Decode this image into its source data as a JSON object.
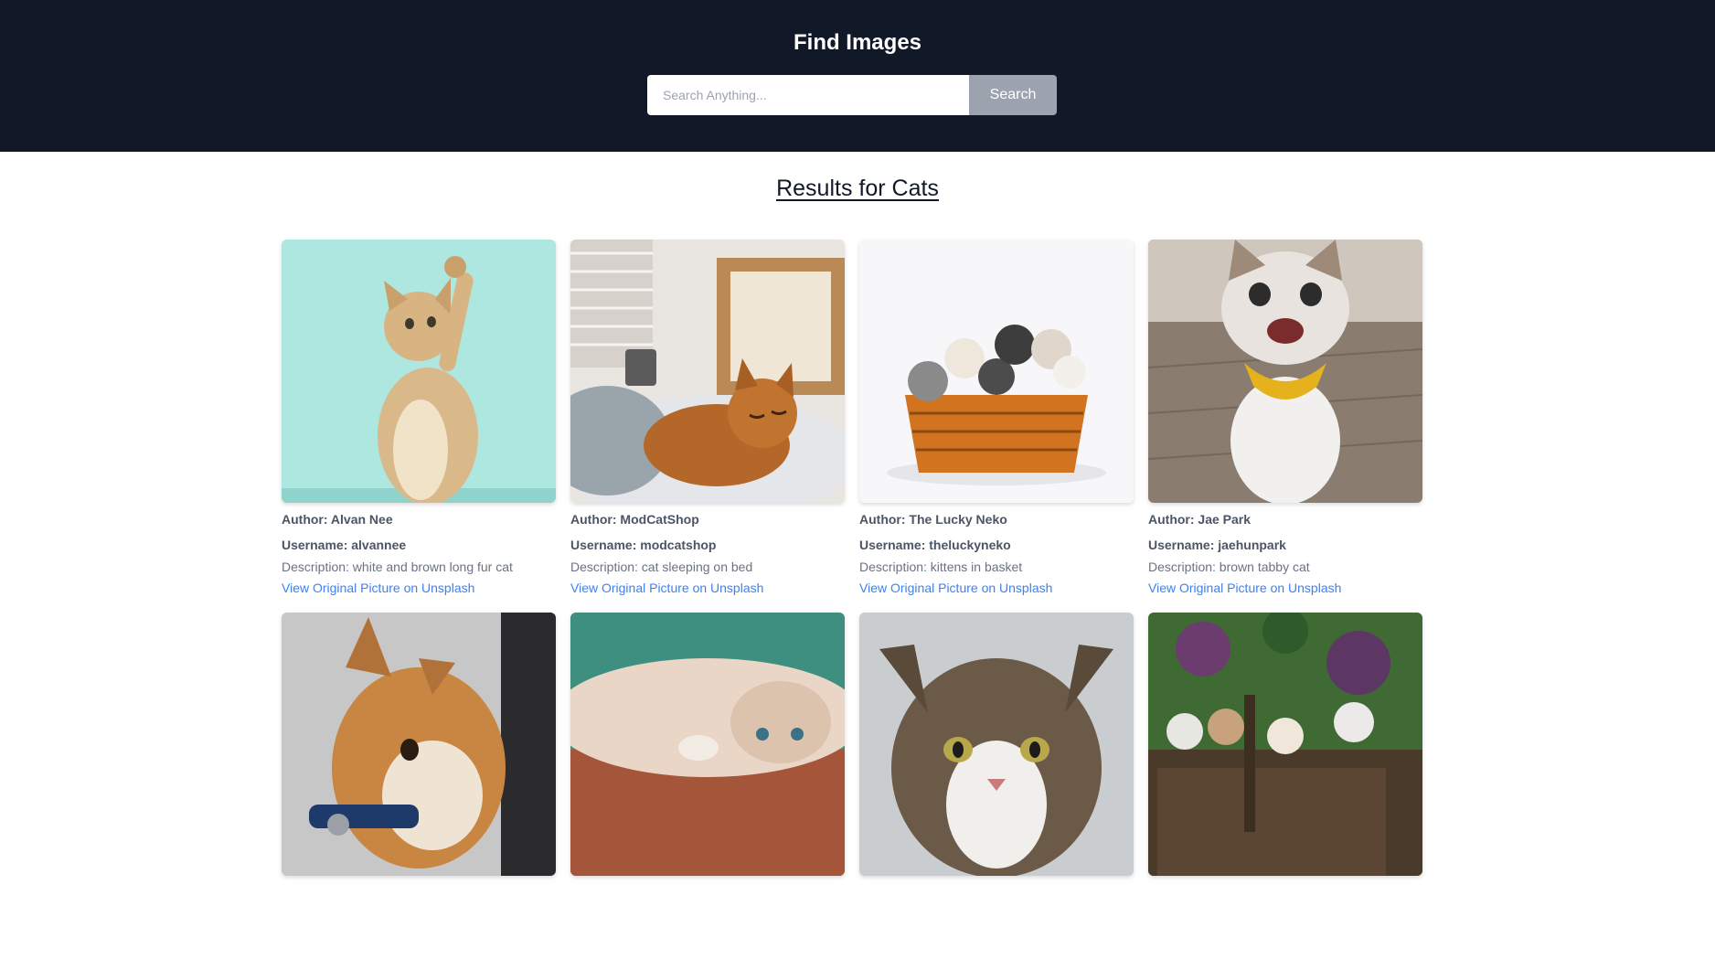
{
  "header": {
    "title": "Find Images",
    "search_placeholder": "Search Anything...",
    "search_button": "Search",
    "background": "#111827"
  },
  "results": {
    "prefix": "Results for ",
    "query": "Cats"
  },
  "cards": [
    {
      "author": "Author: Alvan Nee",
      "username": "Username: alvannee",
      "description": "Description: white and brown long fur cat",
      "link": "View Original Picture on Unsplash"
    },
    {
      "author": "Author: ModCatShop",
      "username": "Username: modcatshop",
      "description": "Description: cat sleeping on bed",
      "link": "View Original Picture on Unsplash"
    },
    {
      "author": "Author: The Lucky Neko",
      "username": "Username: theluckyneko",
      "description": "Description: kittens in basket",
      "link": "View Original Picture on Unsplash"
    },
    {
      "author": "Author: Jae Park",
      "username": "Username: jaehunpark",
      "description": "Description: brown tabby cat",
      "link": "View Original Picture on Unsplash"
    },
    {
      "author": "",
      "username": "",
      "description": "",
      "link": ""
    },
    {
      "author": "",
      "username": "",
      "description": "",
      "link": ""
    },
    {
      "author": "",
      "username": "",
      "description": "",
      "link": ""
    },
    {
      "author": "",
      "username": "",
      "description": "",
      "link": ""
    }
  ],
  "colors": {
    "link": "#3b82f6",
    "search_button": "#9ca3af"
  }
}
